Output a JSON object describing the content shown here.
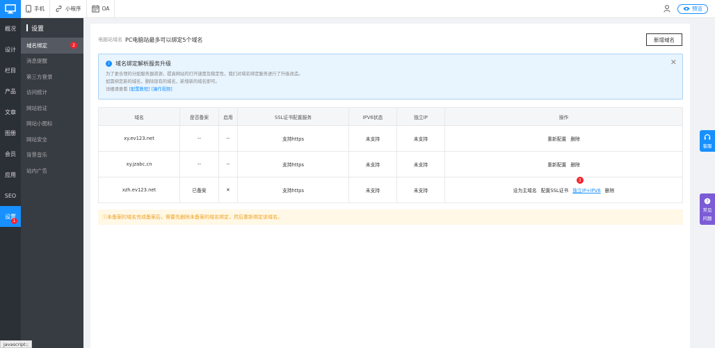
{
  "topbar": {
    "items": [
      {
        "label": "手机",
        "icon": "phone-icon"
      },
      {
        "label": "小程序",
        "icon": "miniprogram-icon"
      },
      {
        "label": "OA",
        "icon": "calendar-icon"
      }
    ],
    "preview_label": "预览"
  },
  "rail": {
    "items": [
      {
        "label": "概况"
      },
      {
        "label": "设计"
      },
      {
        "label": "栏目"
      },
      {
        "label": "产品"
      },
      {
        "label": "文章"
      },
      {
        "label": "图册"
      },
      {
        "label": "会员"
      },
      {
        "label": "应用"
      },
      {
        "label": "SEO"
      },
      {
        "label": "设置",
        "active": true,
        "badge": "1"
      }
    ]
  },
  "subnav": {
    "title": "设置",
    "items": [
      {
        "label": "域名绑定",
        "active": true,
        "badge": "2"
      },
      {
        "label": "消息提醒"
      },
      {
        "label": "第三方登录"
      },
      {
        "label": "访问统计"
      },
      {
        "label": "网站验证"
      },
      {
        "label": "网站小图标"
      },
      {
        "label": "网站安全"
      },
      {
        "label": "背景音乐"
      },
      {
        "label": "站内广告"
      }
    ]
  },
  "header": {
    "label": "电脑站域名",
    "text": "PC电脑站最多可以绑定5个域名",
    "add_button": "新增域名"
  },
  "notice": {
    "title": "域名绑定解析服务升级",
    "line1": "为了更合理的分配服务器资源，提高网站的打开速度及稳定性，我们对域名绑定服务进行了升级改造。",
    "line2": "如需绑定新的域名，删除现有的域名，新增新的域名即可。",
    "line3_prefix": "详细请查看",
    "link1": "[配置教程]",
    "link2": "[操作视频]"
  },
  "table": {
    "headers": [
      "域名",
      "是否备案",
      "启用",
      "SSL证书配置服务",
      "IPV6状态",
      "独立IP",
      "操作"
    ],
    "rows": [
      {
        "domain": "xy.ev123.net",
        "filed": "--",
        "enabled": "--",
        "ssl": "支持https",
        "ipv6": "未支持",
        "ip": "未支持",
        "ops": [
          "重新配置",
          "删除"
        ]
      },
      {
        "domain": "xy.jzabc.cn",
        "filed": "--",
        "enabled": "--",
        "ssl": "支持https",
        "ipv6": "未支持",
        "ip": "未支持",
        "ops": [
          "重新配置",
          "删除"
        ]
      },
      {
        "domain": "xzh.ev123.net",
        "filed": "已备案",
        "enabled": "✕",
        "ssl": "支持https",
        "ipv6": "未支持",
        "ip": "未支持",
        "ops": [
          "设为主域名",
          "配置SSL证书",
          "独立IP+IPV6",
          "删除"
        ],
        "badge": "3"
      }
    ]
  },
  "warning": "ⓘ未备案的域名完成备案后，需要先删除未备案的域名绑定，然后重新绑定该域名。",
  "float": {
    "service": "客服",
    "faq_line1": "常见",
    "faq_line2": "问题"
  },
  "statusbar": "javascript:;",
  "colors": {
    "accent": "#1890ff",
    "rail_bg": "#2b2f36",
    "subnav_bg": "#373b42",
    "badge": "#f5222d",
    "faq": "#7b5cd6"
  }
}
